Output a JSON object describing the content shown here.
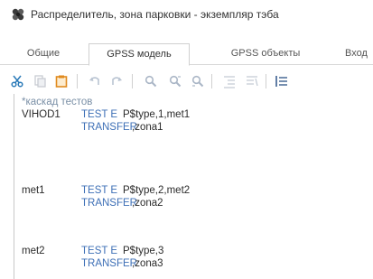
{
  "window": {
    "title": "Распределитель, зона парковки - экземпляр тэба",
    "app_icon": "objects-app-icon"
  },
  "tabs": [
    {
      "label": "Общие",
      "active": false
    },
    {
      "label": "GPSS модель",
      "active": true
    },
    {
      "label": "GPSS объекты",
      "active": false
    },
    {
      "label": "Вход",
      "active": false
    }
  ],
  "toolbar": {
    "buttons": [
      {
        "name": "cut-icon",
        "enabled": true
      },
      {
        "name": "copy-icon",
        "enabled": false
      },
      {
        "name": "paste-icon",
        "enabled": true
      },
      {
        "name": "undo-icon",
        "enabled": false
      },
      {
        "name": "redo-icon",
        "enabled": false
      },
      {
        "name": "find-icon",
        "enabled": false
      },
      {
        "name": "find-next-icon",
        "enabled": false
      },
      {
        "name": "find-prev-icon",
        "enabled": false
      },
      {
        "name": "indent-icon",
        "enabled": false
      },
      {
        "name": "outdent-icon",
        "enabled": false
      },
      {
        "name": "align-icon",
        "enabled": true
      }
    ]
  },
  "code": {
    "comment": "*каскад тестов",
    "blocks": [
      {
        "label": "VIHOD1",
        "line1_op": "TEST E",
        "line1_args": "P$type,1,met1",
        "line2_op": "TRANSFER",
        "line2_args": ",zona1"
      },
      {
        "label": "met1",
        "line1_op": "TEST E",
        "line1_args": "P$type,2,met2",
        "line2_op": "TRANSFER",
        "line2_args": ",zona2"
      },
      {
        "label": "met2",
        "line1_op": "TEST E",
        "line1_args": "P$type,3",
        "line2_op": "TRANSFER",
        "line2_args": ",zona3"
      }
    ]
  },
  "colors": {
    "keyword": "#3d6fb6",
    "comment": "#7a8fa6",
    "text": "#2b2b2b",
    "accent_icon": "#2a7ab8",
    "paste_icon": "#e08a1e"
  }
}
